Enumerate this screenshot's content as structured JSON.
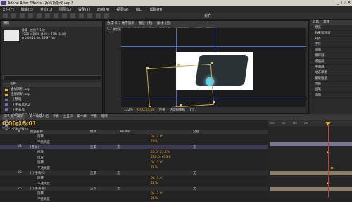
{
  "window": {
    "title": "Adobe After Effects - 挥码功能改.aep *",
    "controls": [
      "_",
      "□",
      "×"
    ]
  },
  "menu": [
    "文件(F)",
    "编辑(E)",
    "合成(C)",
    "图层(L)",
    "效果(T)",
    "动画(A)",
    "视图(V)",
    "窗口",
    "帮助(H)"
  ],
  "toolbar": {
    "snap_label": "对齐"
  },
  "project_panel": {
    "tab": "项目",
    "info_title": "隐藏 · 使用了 1 次",
    "info_lines": [
      "1920 x 1080 (400 x 270) (1.00)",
      "Δ 0;00;15;00, 29.97 fps"
    ],
    "search_placeholder": "ρ",
    "column_header": "名称",
    "items": [
      {
        "type": "folder",
        "label": "虚拟风机.aep"
      },
      {
        "type": "folder",
        "label": "连接风机.aep"
      },
      {
        "type": "comp",
        "label": "[ ] 整理"
      },
      {
        "type": "comp",
        "label": "[ ] 手表风机2"
      },
      {
        "type": "comp",
        "label": "[ ] 手表风"
      },
      {
        "type": "comp",
        "label": "[ ] 手表风机2222222"
      },
      {
        "type": "comp",
        "label": "[ ] 手表风机"
      },
      {
        "type": "comp",
        "label": "[ ] 手表风动"
      },
      {
        "type": "comp",
        "label": "[ ] 手表风P2"
      }
    ]
  },
  "composition_panel": {
    "tabs": [
      "合成: 5-7 数字演示",
      "图层: (无)",
      "素材: (无)"
    ],
    "sub_tabs": [
      "5-7 数字演示",
      "第一场景介绍",
      "手表",
      "手表加载",
      "主显示画面",
      "主显示",
      "手表系统"
    ],
    "footer": {
      "zoom": "122%",
      "timecode": "0;00;15;01",
      "quality": "完整",
      "camera": "活动摄像机",
      "views": "1个..."
    }
  },
  "side_panel": {
    "tabs": [
      "信息",
      "音频"
    ],
    "rows": [
      "预览",
      "效果和预设",
      "对齐",
      "字符",
      "段落",
      "跟踪器",
      "摇摆器",
      "平滑器",
      "动态草图",
      "蒙版插值",
      "绘画",
      "画笔",
      "段落"
    ]
  },
  "timeline": {
    "tabs": [
      "5-7 数字演示",
      "第一场景介绍",
      "手表",
      "主显示",
      "第一屏",
      "手表",
      "缝隙"
    ],
    "active_tab": "5-7 数字演示",
    "current_time": "0;00;15;01",
    "time_sub": "00451 (29.97 fps)",
    "columns": [
      "#",
      "图层名称",
      "模式",
      "T TrkMat",
      "父级"
    ],
    "rows": [
      {
        "num": "",
        "name": "旋转",
        "mode": "",
        "trk": "",
        "value": "0x -1.0°",
        "parent": "",
        "kind": "prop"
      },
      {
        "num": "",
        "name": "不透明度",
        "mode": "",
        "trk": "",
        "value": "79%",
        "parent": "",
        "kind": "prop"
      },
      {
        "num": "24",
        "name": "[整体]",
        "mode": "正常",
        "trk": "无",
        "value": "",
        "parent": "无",
        "kind": "sel"
      },
      {
        "num": "",
        "name": "缩放",
        "mode": "",
        "trk": "",
        "value": "25.0, 23.4%",
        "parent": "",
        "kind": "prop"
      },
      {
        "num": "",
        "name": "位置",
        "mode": "",
        "trk": "",
        "value": "280.0, 633.0",
        "parent": "",
        "kind": "prop"
      },
      {
        "num": "",
        "name": "旋转",
        "mode": "",
        "trk": "",
        "value": "0x -1.0°",
        "parent": "",
        "kind": "prop"
      },
      {
        "num": "",
        "name": "不透明度",
        "mode": "",
        "trk": "",
        "value": "71%",
        "parent": "",
        "kind": "prop"
      },
      {
        "num": "25",
        "name": "[ ] 手表P2",
        "mode": "正常",
        "trk": "无",
        "value": "",
        "parent": "无",
        "kind": "layer"
      },
      {
        "num": "",
        "name": "旋转",
        "mode": "",
        "trk": "",
        "value": "0x -1.0°",
        "parent": "",
        "kind": "prop"
      },
      {
        "num": "",
        "name": "不透明度",
        "mode": "",
        "trk": "",
        "value": "21%",
        "parent": "",
        "kind": "prop"
      },
      {
        "num": "26",
        "name": "[ ] 手表钢]",
        "mode": "正常",
        "trk": "无",
        "value": "",
        "parent": "无",
        "kind": "layer"
      },
      {
        "num": "",
        "name": "旋转",
        "mode": "",
        "trk": "",
        "value": "0x -1.0°",
        "parent": "",
        "kind": "prop"
      },
      {
        "num": "",
        "name": "不透明度",
        "mode": "",
        "trk": "",
        "value": "21%",
        "parent": "",
        "kind": "prop"
      }
    ],
    "ruler_marks": [
      "00f",
      "00f",
      "15s",
      "20f"
    ]
  },
  "colors": {
    "accent": "#e8b43a",
    "guide": "#4d6bd6",
    "playhead": "#e03030"
  }
}
